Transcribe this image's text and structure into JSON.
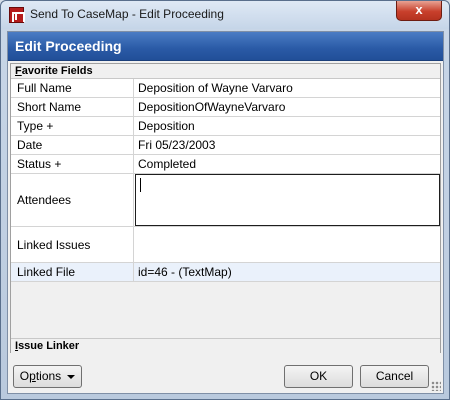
{
  "window": {
    "title": "Send To CaseMap - Edit Proceeding",
    "close_glyph": "x",
    "app_icon": "casemap-app-icon"
  },
  "header": {
    "title": "Edit Proceeding"
  },
  "sections": {
    "favorite_fields": {
      "first_char": "F",
      "rest": "avorite Fields"
    },
    "issue_linker": {
      "first_char": "I",
      "rest": "ssue Linker"
    }
  },
  "fields": {
    "full_name": {
      "label": "Full Name",
      "value": "Deposition of Wayne Varvaro"
    },
    "short_name": {
      "label": "Short Name",
      "value": "DepositionOfWayneVarvaro"
    },
    "type": {
      "label": "Type +",
      "value": "Deposition"
    },
    "date": {
      "label": "Date",
      "value": "Fri 05/23/2003"
    },
    "status": {
      "label": "Status +",
      "value": "Completed"
    },
    "attendees": {
      "label": "Attendees",
      "value": ""
    },
    "linked_issues": {
      "label": "Linked Issues",
      "value": ""
    },
    "linked_file": {
      "label": "Linked File",
      "value": "id=46 - (TextMap)"
    }
  },
  "footer": {
    "options": {
      "first_char": "p",
      "prefix": "O",
      "rest": "tions"
    },
    "ok_label": "OK",
    "cancel_label": "Cancel"
  }
}
